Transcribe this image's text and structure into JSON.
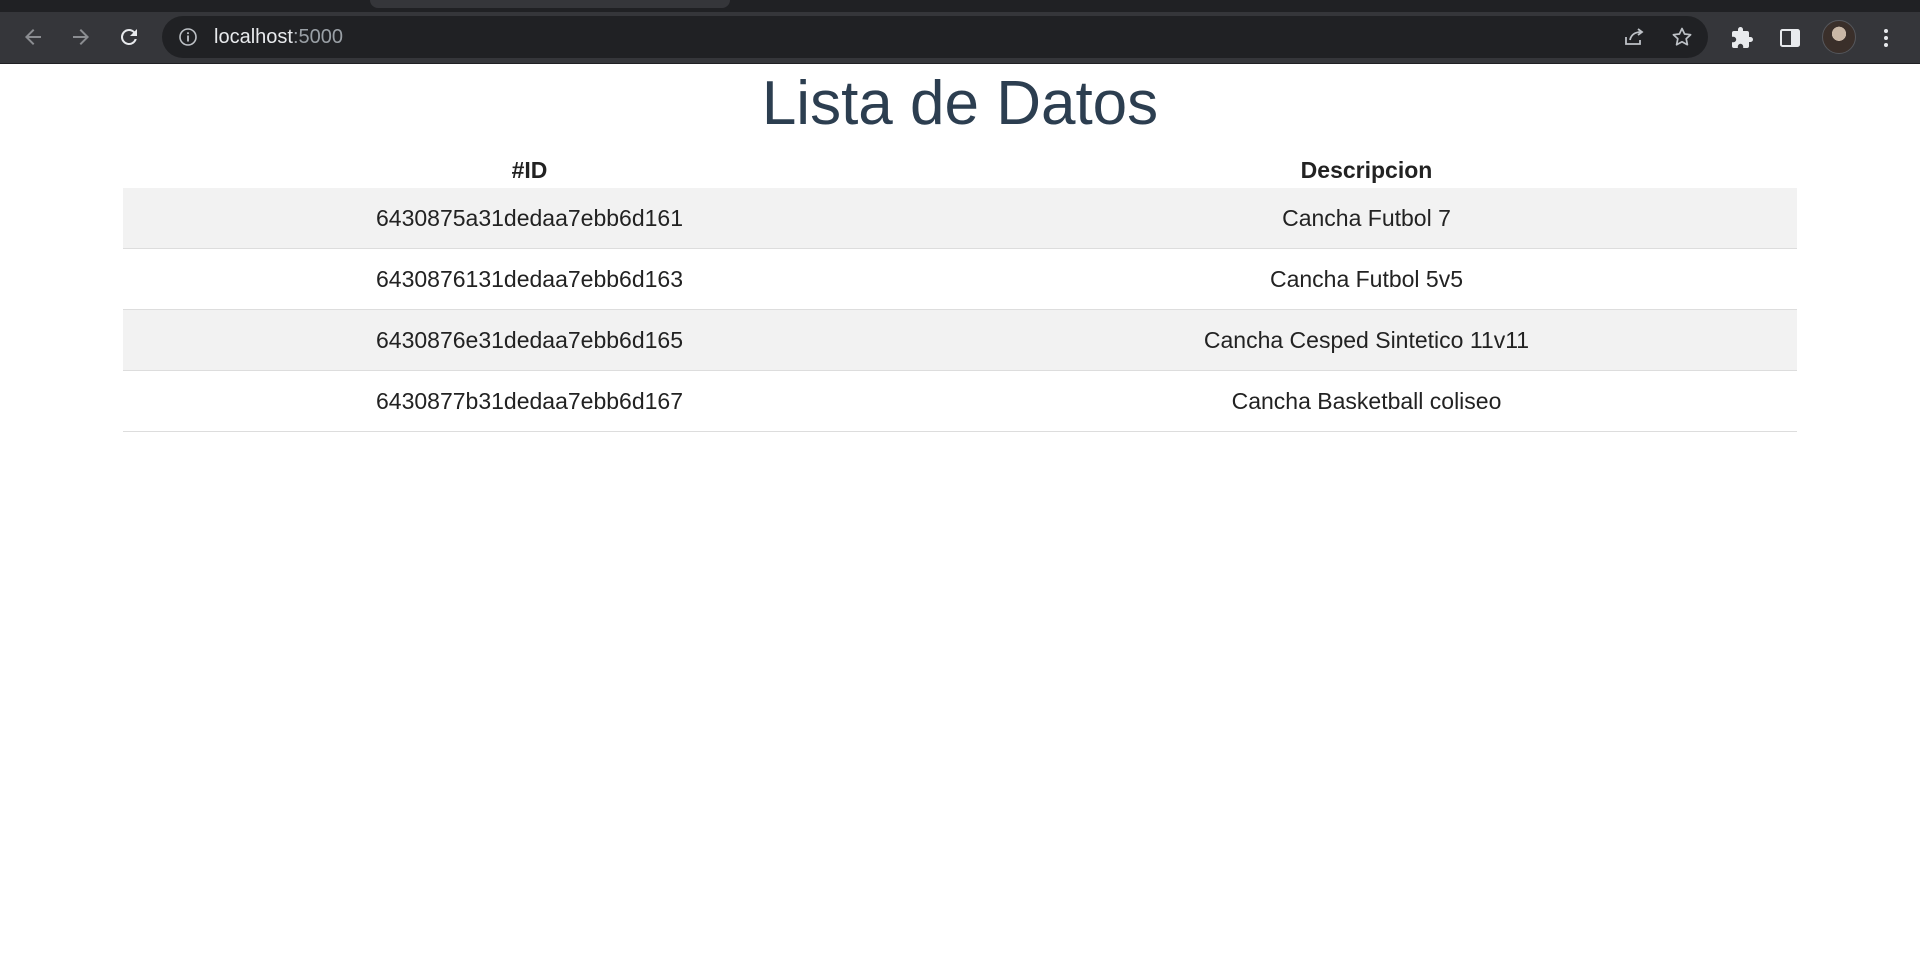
{
  "browser": {
    "url_host": "localhost",
    "url_port": ":5000"
  },
  "page": {
    "title": "Lista de Datos",
    "table": {
      "headers": [
        "#ID",
        "Descripcion"
      ],
      "rows": [
        {
          "id": "6430875a31dedaa7ebb6d161",
          "descripcion": "Cancha Futbol 7"
        },
        {
          "id": "6430876131dedaa7ebb6d163",
          "descripcion": "Cancha Futbol 5v5"
        },
        {
          "id": "6430876e31dedaa7ebb6d165",
          "descripcion": "Cancha Cesped Sintetico 11v11"
        },
        {
          "id": "6430877b31dedaa7ebb6d167",
          "descripcion": "Cancha Basketball coliseo"
        }
      ]
    }
  },
  "colors": {
    "title": "#2c3e50",
    "row_stripe": "#f2f2f2",
    "toolbar_bg": "#35363a",
    "omnibox_bg": "#202124"
  },
  "icons": {
    "back": "arrow-left-icon",
    "forward": "arrow-right-icon",
    "reload": "reload-icon",
    "site_info": "info-icon",
    "share": "share-icon",
    "bookmark": "star-icon",
    "extensions": "puzzle-icon",
    "side_panel": "side-panel-icon",
    "profile": "avatar",
    "menu": "kebab-menu-icon"
  }
}
